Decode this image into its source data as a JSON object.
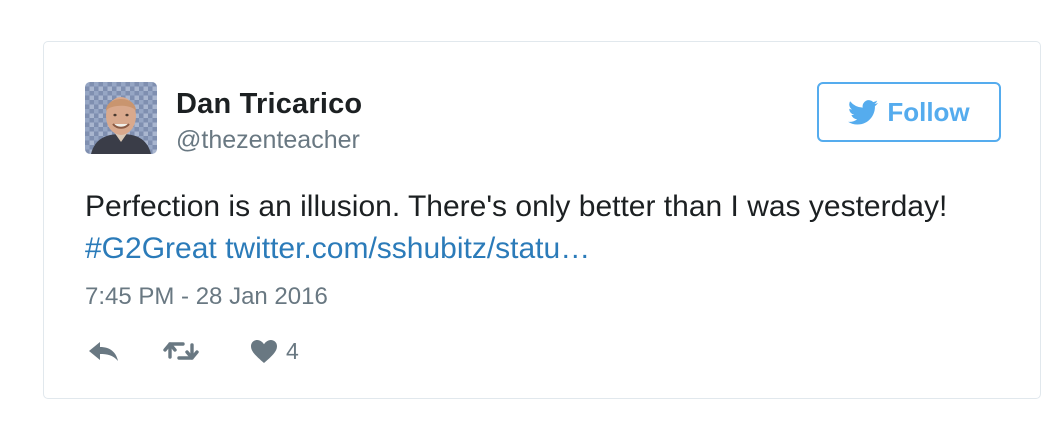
{
  "tweet": {
    "author": {
      "name": "Dan Tricarico",
      "handle": "@thezenteacher",
      "avatar_icon": "profile-photo"
    },
    "follow": {
      "label": "Follow",
      "icon": "twitter-bird-icon",
      "color": "#55acee"
    },
    "text": {
      "body": "Perfection is an illusion. There's only better than I was yesterday! ",
      "hashtag": "#G2Great",
      "link": "twitter.com/sshubitz/statu…"
    },
    "timestamp": "7:45 PM - 28 Jan 2016",
    "actions": {
      "reply_icon": "reply-icon",
      "retweet_icon": "retweet-icon",
      "like_icon": "heart-icon",
      "like_count": "4"
    },
    "colors": {
      "link": "#2b7bb9",
      "text": "#1c2022",
      "muted": "#697882",
      "border": "#e1e8ed"
    }
  }
}
